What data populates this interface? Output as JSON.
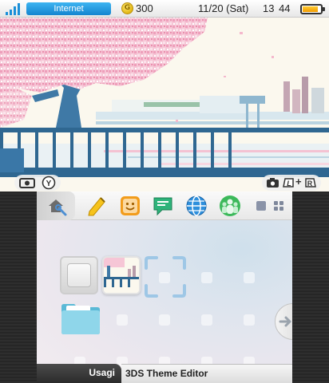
{
  "status_bar": {
    "connection_label": "Internet",
    "coin_symbol": "G",
    "coin_count": "300",
    "date": "11/20 (Sat)",
    "time": "13 44",
    "battery_level": 0.8,
    "icons": [
      "wifi-signal-icon",
      "coin-icon",
      "battery-icon"
    ]
  },
  "top_screen": {
    "theme_image": "cherry-blossom-tree-by-river-bridge",
    "hints": {
      "camera": [
        "camera-icon",
        "y-button-icon"
      ],
      "screenshot": [
        "camera-icon",
        "l-button-icon",
        "+",
        "r-button-icon"
      ]
    },
    "hint_plus": "+",
    "hint_y": "Y",
    "hint_l": "L",
    "hint_r": "R"
  },
  "toolbar": {
    "icons": [
      "home-settings-icon",
      "game-notes-icon",
      "miiverse-icon",
      "notifications-icon",
      "internet-browser-icon",
      "friend-list-icon",
      "view-toggle-icon",
      "grid-layout-icon"
    ]
  },
  "home_menu": {
    "slots": [
      "empty-slot",
      "theme-app-icon",
      "selection-cursor",
      "folder-icon"
    ]
  },
  "footer": {
    "user_name": "Usagi",
    "app_title": "3DS Theme Editor"
  },
  "colors": {
    "accent_blue": "#1f97e0",
    "blossom_pink": "#f4b8cc",
    "tree_blue": "#3f79a6"
  }
}
